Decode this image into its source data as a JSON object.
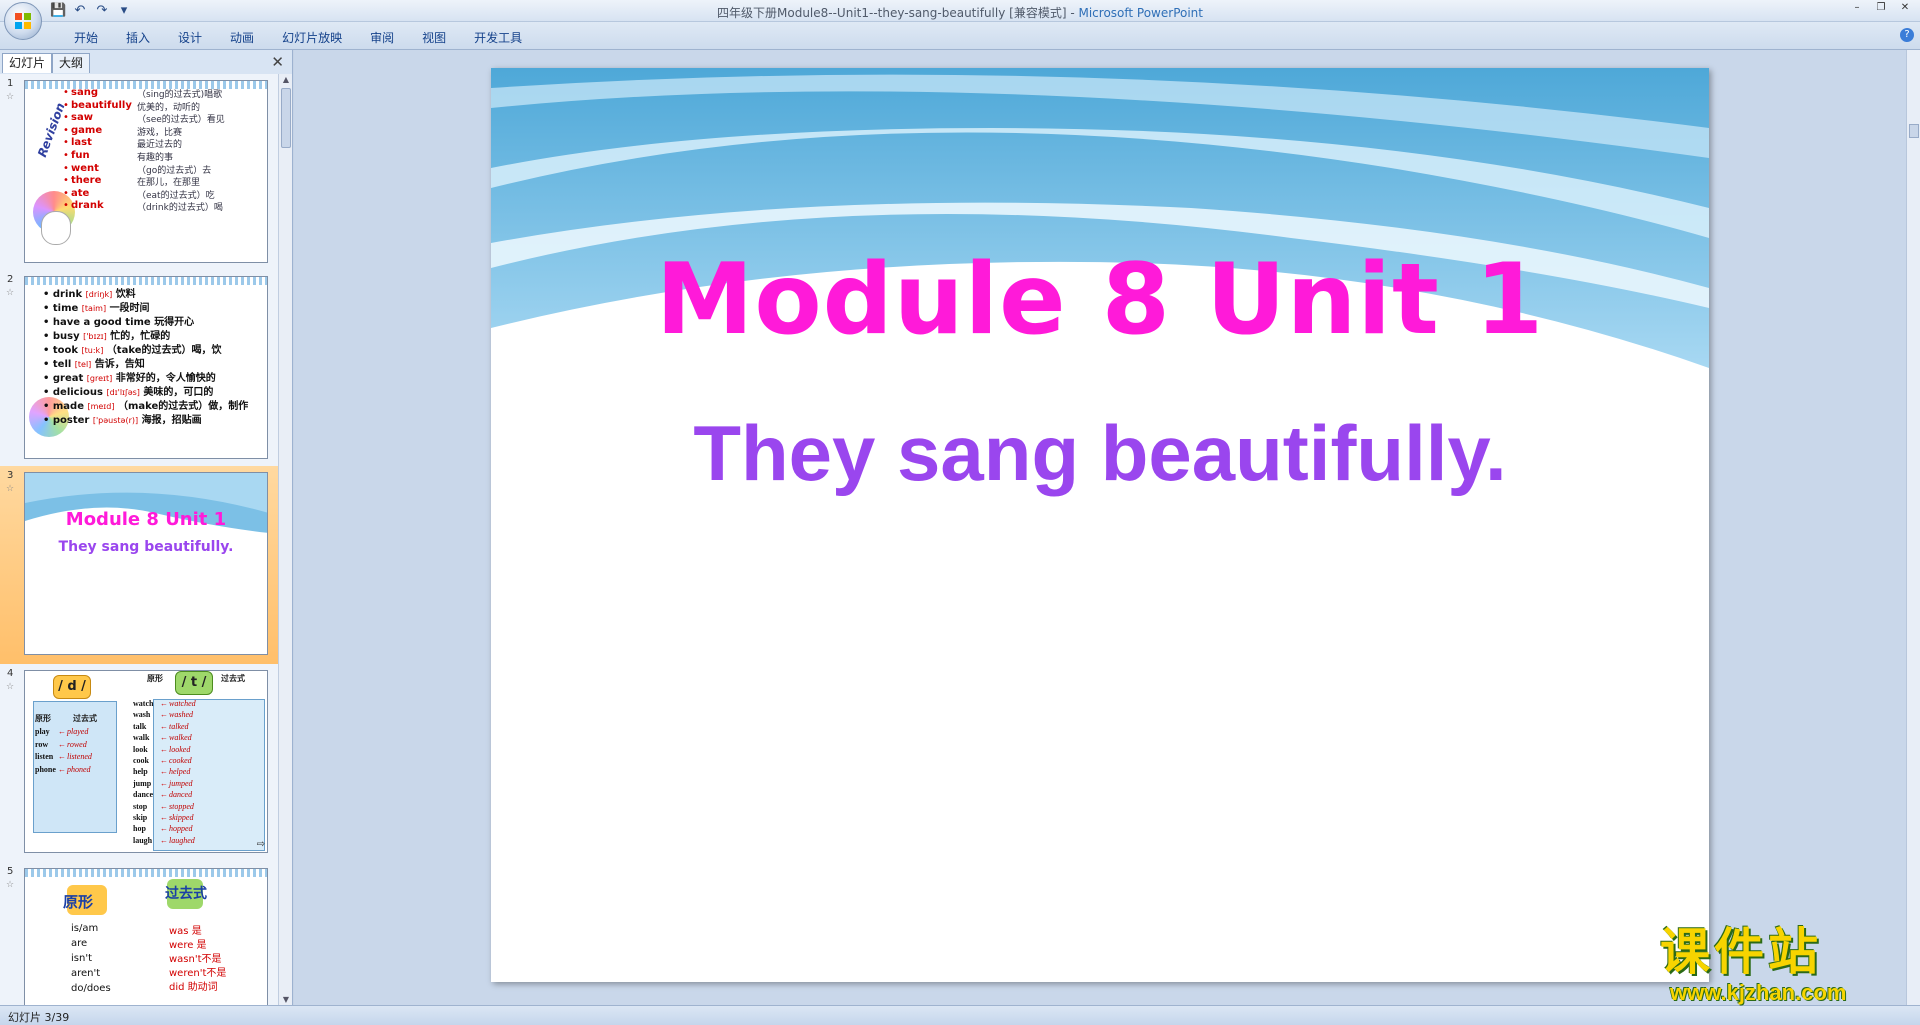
{
  "window": {
    "title": "四年级下册Module8--Unit1--they-sang-beautifully [兼容模式]",
    "app_name": "Microsoft PowerPoint"
  },
  "ribbon": {
    "tabs": [
      "开始",
      "插入",
      "设计",
      "动画",
      "幻灯片放映",
      "审阅",
      "视图",
      "开发工具"
    ]
  },
  "left_panel": {
    "tab_slides": "幻灯片",
    "tab_outline": "大纲",
    "thumb1": {
      "side_title": "Revision",
      "rows": [
        {
          "en": "sang",
          "cn": "（sing的过去式)唱歌"
        },
        {
          "en": "beautifully",
          "cn": "优美的，动听的"
        },
        {
          "en": "saw",
          "cn": "（see的过去式）看见"
        },
        {
          "en": "game",
          "cn": "游戏，比赛"
        },
        {
          "en": "last",
          "cn": "最近过去的"
        },
        {
          "en": "fun",
          "cn": "有趣的事"
        },
        {
          "en": "went",
          "cn": "（go的过去式）去"
        },
        {
          "en": "there",
          "cn": "在那儿，在那里"
        },
        {
          "en": "ate",
          "cn": "（eat的过去式）吃"
        },
        {
          "en": "drank",
          "cn": "（drink的过去式）喝"
        }
      ]
    },
    "thumb2": {
      "rows": [
        {
          "en": "drink",
          "ph": "[driŋk]",
          "cn": "饮料"
        },
        {
          "en": "time",
          "ph": "[taim]",
          "cn": "一段时间"
        },
        {
          "en": "have a good time",
          "ph": "",
          "cn": "玩得开心"
        },
        {
          "en": "busy",
          "ph": "['bɪzɪ]",
          "cn": "忙的，忙碌的"
        },
        {
          "en": "took",
          "ph": "[tu:k]",
          "cn": "（take的过去式）喝，饮"
        },
        {
          "en": "tell",
          "ph": "[tel]",
          "cn": "告诉，告知"
        },
        {
          "en": "great",
          "ph": "[greɪt]",
          "cn": "非常好的，令人愉快的"
        },
        {
          "en": "delicious",
          "ph": "[dɪ'lɪʃəs]",
          "cn": "美味的，可口的"
        },
        {
          "en": "made",
          "ph": "[meɪd]",
          "cn": "（make的过去式）做，制作"
        },
        {
          "en": "poster",
          "ph": "['pəustə(r)]",
          "cn": "海报，招贴画"
        }
      ]
    },
    "thumb3": {
      "title": "Module 8 Unit 1",
      "subtitle": "They sang beautifully."
    },
    "thumb4": {
      "d_label": "/ d /",
      "t_label": "/ t /",
      "col_base": "原形",
      "col_past": "过去式",
      "d_words": [
        [
          "play",
          "played"
        ],
        [
          "row",
          "rowed"
        ],
        [
          "listen",
          "listened"
        ],
        [
          "phone",
          "phoned"
        ]
      ],
      "t_words": [
        [
          "watch",
          "watched"
        ],
        [
          "wash",
          "washed"
        ],
        [
          "talk",
          "talked"
        ],
        [
          "walk",
          "walked"
        ],
        [
          "look",
          "looked"
        ],
        [
          "cook",
          "cooked"
        ],
        [
          "help",
          "helped"
        ],
        [
          "jump",
          "jumped"
        ],
        [
          "dance",
          "danced"
        ],
        [
          "stop",
          "stopped"
        ],
        [
          "skip",
          "skipped"
        ],
        [
          "hop",
          "hopped"
        ],
        [
          "laugh",
          "laughed"
        ]
      ]
    },
    "thumb5": {
      "col_base": "原形",
      "col_past": "过去式",
      "base": [
        "is/am",
        "are",
        "isn't",
        "aren't",
        "do/does"
      ],
      "past": [
        "was 是",
        "were 是",
        "wasn't不是",
        "weren't不是",
        "did 助动词"
      ]
    }
  },
  "slide": {
    "title": "Module  8  Unit 1",
    "subtitle": "They sang beautifully."
  },
  "status": {
    "slide_counter": "幻灯片 3/39"
  },
  "watermark": {
    "cn": "课件站",
    "url": "www.kjzhan.com"
  },
  "colors": {
    "title_magenta": "#ff1ad9",
    "subtitle_purple": "#9a46ee",
    "selection_orange": "#ffbf6a",
    "sky_blue": "#5fb0dd"
  }
}
